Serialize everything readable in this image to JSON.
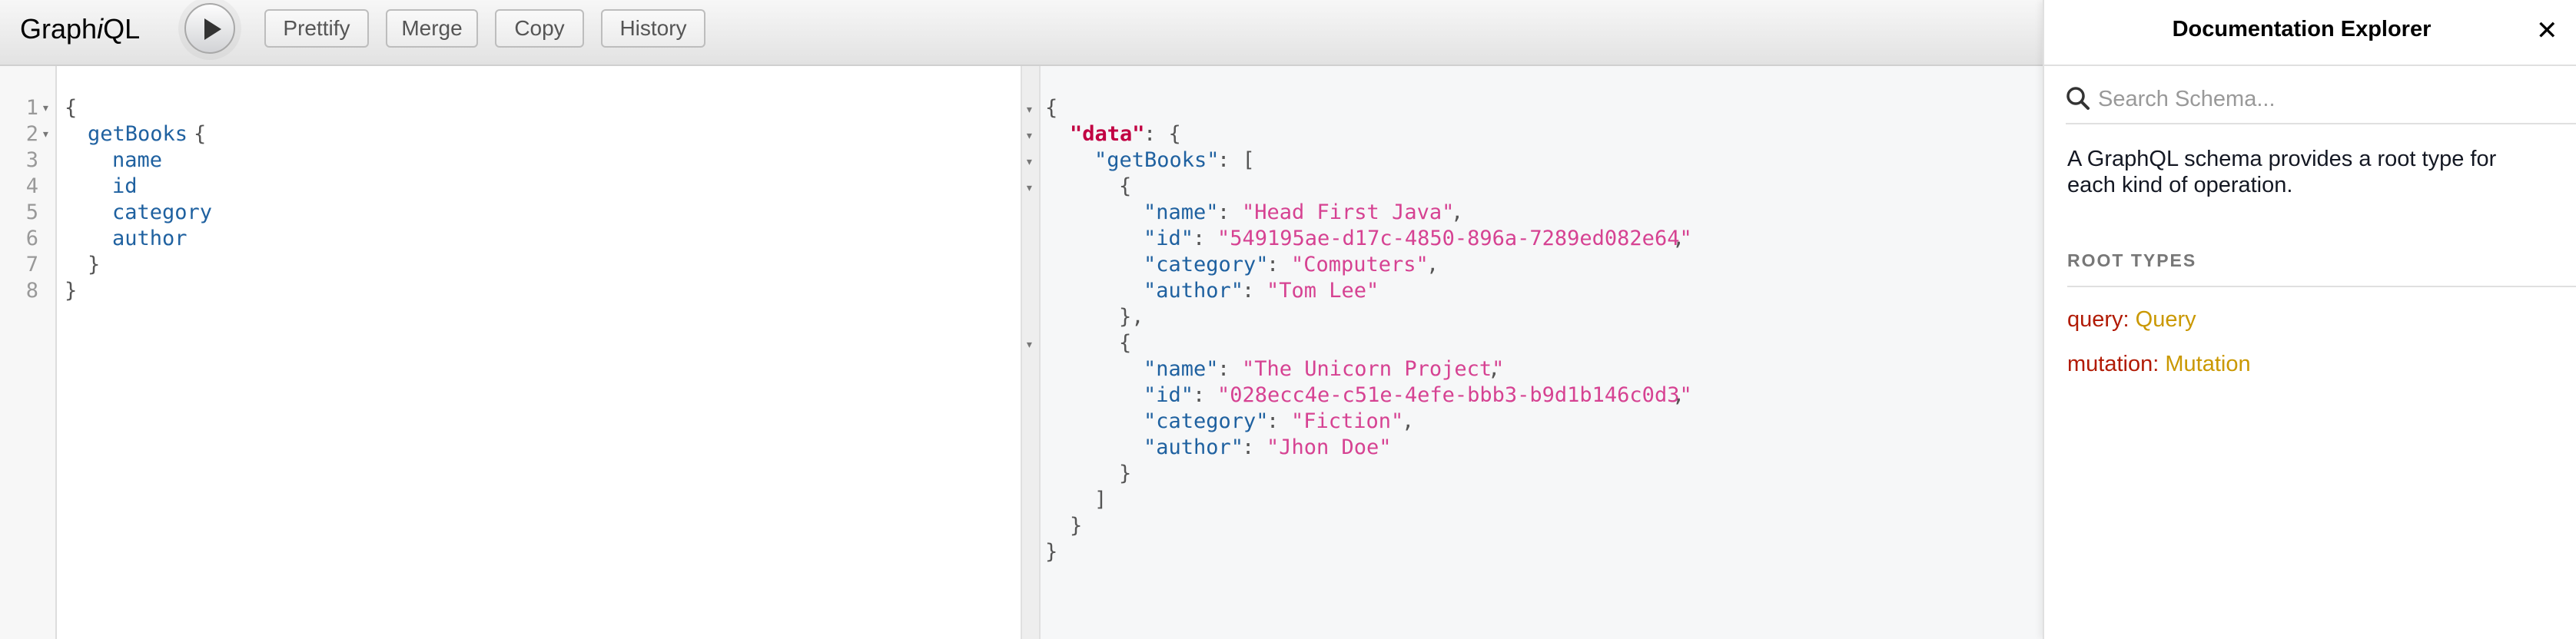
{
  "toolbar": {
    "brand_prefix": "Graph",
    "brand_italic": "i",
    "brand_suffix": "QL",
    "execute_icon": "play-icon",
    "buttons": [
      "Prettify",
      "Merge",
      "Copy",
      "History"
    ]
  },
  "query_editor": {
    "line_numbers": [
      "1",
      "2",
      "3",
      "4",
      "5",
      "6",
      "7",
      "8"
    ],
    "fold_marker": "▾",
    "lines": {
      "l1": "{",
      "l2_field": "getBooks",
      "l2_brace": "{",
      "l3": "name",
      "l4": "id",
      "l5": "category",
      "l6": "author",
      "l7": "}",
      "l8": "}"
    }
  },
  "result": {
    "open_brace": "{",
    "data_key": "\"data\"",
    "colon_open_brace": ": {",
    "getbooks_key": "\"getBooks\"",
    "colon_open_bracket": ": [",
    "item_open": "{",
    "item_close_comma": "},",
    "item_close": "}",
    "bracket_close": "]",
    "brace_close": "}",
    "books": [
      {
        "name_key": "\"name\"",
        "name_val": "\"Head First Java\"",
        "id_key": "\"id\"",
        "id_val": "\"549195ae-d17c-4850-896a-7289ed082e64\"",
        "category_key": "\"category\"",
        "category_val": "\"Computers\"",
        "author_key": "\"author\"",
        "author_val": "\"Tom Lee\""
      },
      {
        "name_key": "\"name\"",
        "name_val": "\"The Unicorn Project\"",
        "id_key": "\"id\"",
        "id_val": "\"028ecc4e-c51e-4efe-bbb3-b9d1b146c0d3\"",
        "category_key": "\"category\"",
        "category_val": "\"Fiction\"",
        "author_key": "\"author\"",
        "author_val": "\"Jhon Doe\""
      }
    ]
  },
  "docs": {
    "title": "Documentation Explorer",
    "close": "✕",
    "search_placeholder": "Search Schema...",
    "description": "A GraphQL schema provides a root type for each kind of operation.",
    "section_title": "ROOT TYPES",
    "root_types": [
      {
        "field": "query",
        "type": "Query"
      },
      {
        "field": "mutation",
        "type": "Mutation"
      }
    ]
  }
}
